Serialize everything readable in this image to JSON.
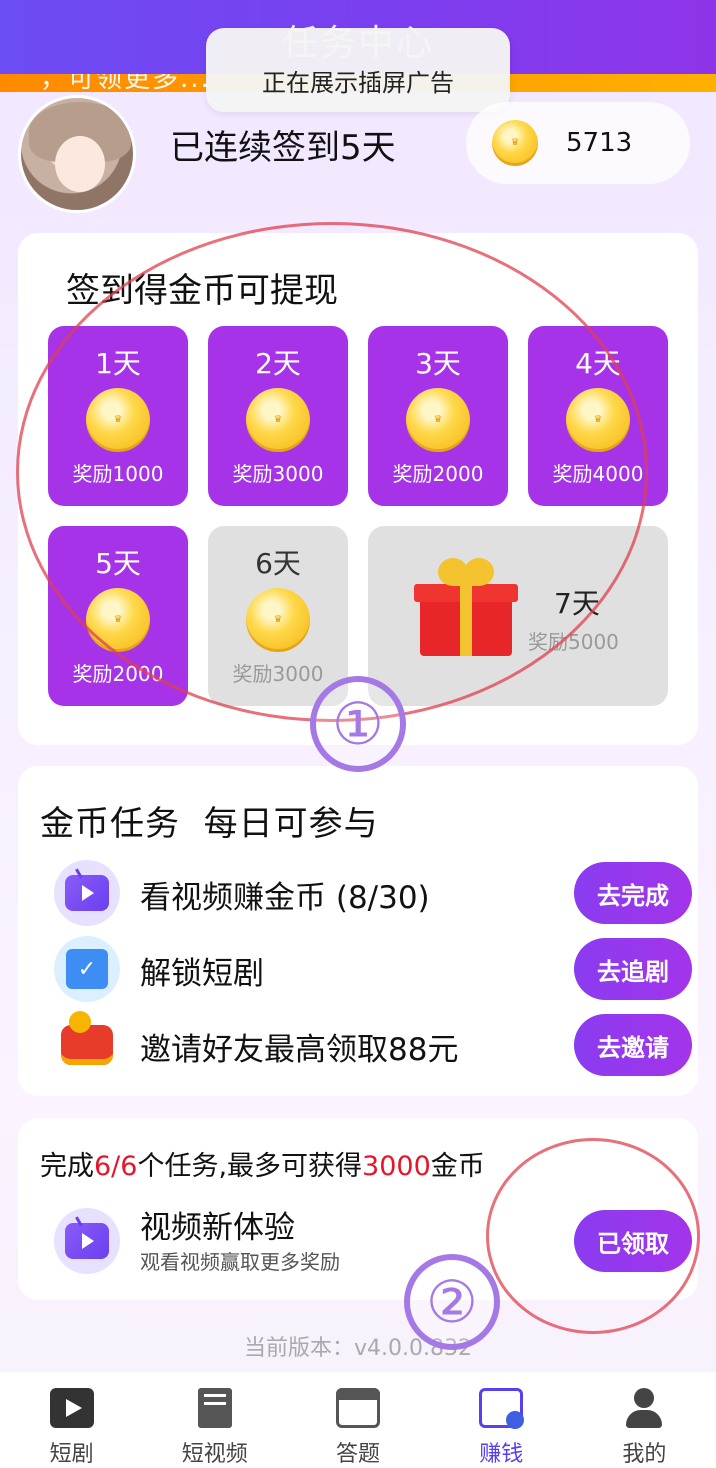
{
  "header": {
    "title": "任务中心",
    "marquee": "，可领更多...",
    "toast": "正在展示插屏广告"
  },
  "profile": {
    "streak_text": "已连续签到5天",
    "coins": "5713"
  },
  "signin": {
    "title": "签到得金币可提现",
    "days": [
      {
        "label": "1天",
        "reward": "奖励1000",
        "done": true
      },
      {
        "label": "2天",
        "reward": "奖励3000",
        "done": true
      },
      {
        "label": "3天",
        "reward": "奖励2000",
        "done": true
      },
      {
        "label": "4天",
        "reward": "奖励4000",
        "done": true
      },
      {
        "label": "5天",
        "reward": "奖励2000",
        "done": true
      },
      {
        "label": "6天",
        "reward": "奖励3000",
        "done": false
      },
      {
        "label": "7天",
        "reward": "奖励5000",
        "done": false
      }
    ]
  },
  "tasks": {
    "title": "金币任务  每日可参与",
    "items": [
      {
        "icon": "tv-icon",
        "label": "看视频赚金币 (8/30)",
        "button": "去完成"
      },
      {
        "icon": "calendar-check-icon",
        "label": "解锁短剧",
        "button": "去追剧"
      },
      {
        "icon": "wallet-icon",
        "label": "邀请好友最高领取88元",
        "button": "去邀请"
      }
    ]
  },
  "bonus": {
    "title_prefix": "完成",
    "title_progress": "6/6",
    "title_mid": "个任务,最多可获得",
    "title_amount": "3000",
    "title_suffix": "金币",
    "item_label": "视频新体验",
    "item_sub": "观看视频赢取更多奖励",
    "button": "已领取"
  },
  "version": "当前版本：v4.0.0.832",
  "annotations": {
    "one": "①",
    "two": "②"
  },
  "nav": {
    "items": [
      {
        "label": "短剧",
        "icon": "play-icon"
      },
      {
        "label": "短视频",
        "icon": "book-icon"
      },
      {
        "label": "答题",
        "icon": "shop-icon"
      },
      {
        "label": "赚钱",
        "icon": "calendar-icon",
        "active": true
      },
      {
        "label": "我的",
        "icon": "person-icon"
      }
    ]
  },
  "colors": {
    "accent": "#a633e8",
    "header": "#7b3ff0",
    "highlight": "#e8152a",
    "nav_active": "#5a3ff2"
  }
}
